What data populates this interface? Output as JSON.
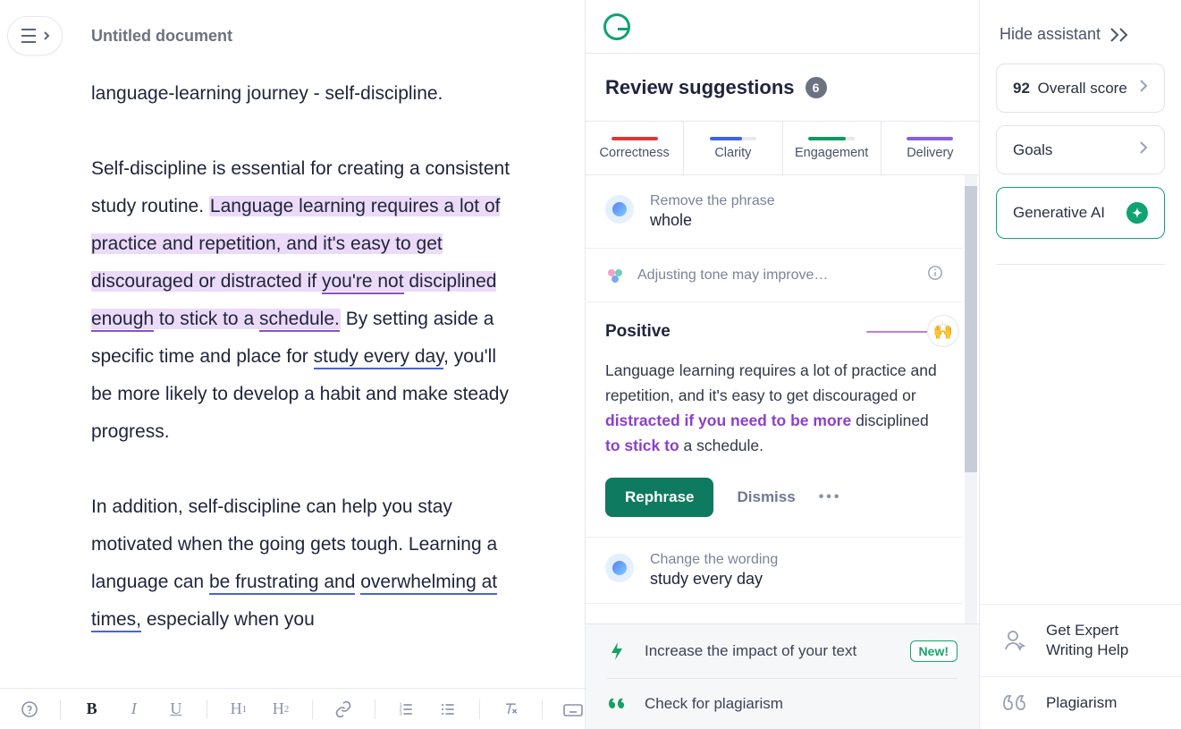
{
  "editor": {
    "doc_title": "Untitled document",
    "line1": "language-learning journey - self-discipline.",
    "p2": {
      "a": "Self-discipline is essential for creating a consistent study routine. ",
      "hl1": "Language learning requires a lot of practice and repetition, and it's easy to get discouraged or distracted if ",
      "youre_not": "you're not",
      "sp1": " disciplined ",
      "enough": "enough",
      "hl3": " to stick to a ",
      "schedule": "schedule.",
      "b": " By setting aside a specific time and place for ",
      "study": "study every day",
      "c": ", you'll be more likely to develop a habit and make steady progress."
    },
    "p3": {
      "a": "In addition, self-discipline can help you stay motivated when the going gets tough. Learning a language can ",
      "frust": "be frustrating and",
      "sp": " ",
      "over": "overwhelming at times,",
      "b": " especially when you"
    }
  },
  "toolbar": {
    "help": "?",
    "B": "B",
    "I": "I",
    "U": "U",
    "H1a": "H",
    "H1b": "1",
    "H2a": "H",
    "H2b": "2"
  },
  "sug": {
    "title": "Review suggestions",
    "count": "6",
    "cats": {
      "c1": "Correctness",
      "c2": "Clarity",
      "c3": "Engagement",
      "c4": "Delivery"
    },
    "item1": {
      "label": "Remove the phrase",
      "main": "whole"
    },
    "tone": "Adjusting tone may improve…",
    "positive": {
      "title": "Positive",
      "emoji": "🙌",
      "t1": "Language learning requires a lot of practice and repetition, and it's easy to get discouraged or ",
      "p1": "distracted if you need to be more",
      "t2": " disciplined ",
      "p2": "to stick to",
      "t3": " a schedule.",
      "rephrase": "Rephrase",
      "dismiss": "Dismiss"
    },
    "item3": {
      "label": "Change the wording",
      "main": "study every day"
    },
    "footer": {
      "impact": "Increase the impact of your text",
      "new": "New!",
      "plag": "Check for plagiarism"
    }
  },
  "right": {
    "hide": "Hide assistant",
    "score_num": "92",
    "score_lbl": " Overall score",
    "goals": "Goals",
    "gen": "Generative AI",
    "expert": "Get Expert Writing Help",
    "plag": "Plagiarism"
  }
}
